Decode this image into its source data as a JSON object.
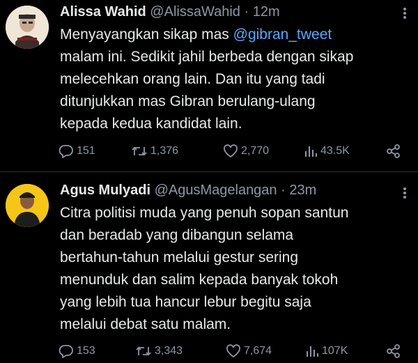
{
  "tweets": [
    {
      "name": "Alissa Wahid",
      "handle": "@AlissaWahid",
      "separator": "·",
      "time": "12m",
      "lines": [
        {
          "before": "Menyayangkan sikap mas ",
          "mention": "@gibran_tweet",
          "after": ""
        },
        {
          "before": "malam ini. Sedikit jahil berbeda dengan sikap",
          "mention": "",
          "after": ""
        },
        {
          "before": "melecehkan orang lain. Dan itu yang tadi",
          "mention": "",
          "after": ""
        },
        {
          "before": "ditunjukkan mas Gibran berulang-ulang",
          "mention": "",
          "after": ""
        },
        {
          "before": "kepada kedua kandidat lain.",
          "mention": "",
          "after": ""
        }
      ],
      "stats": {
        "replies": "151",
        "retweets": "1,376",
        "likes": "2,770",
        "views": "43.5K"
      }
    },
    {
      "name": "Agus Mulyadi",
      "handle": "@AgusMagelangan",
      "separator": "·",
      "time": "23m",
      "lines": [
        {
          "before": "Citra politisi muda yang penuh sopan santun"
        },
        {
          "before": "dan beradab yang dibangun selama"
        },
        {
          "before": "bertahun-tahun melalui gestur sering"
        },
        {
          "before": "menunduk dan salim kepada banyak tokoh"
        },
        {
          "before": "yang lebih tua hancur lebur begitu saja"
        },
        {
          "before": "melalui debat satu malam."
        }
      ],
      "stats": {
        "replies": "153",
        "retweets": "3,343",
        "likes": "7,674",
        "views": "107K"
      }
    }
  ],
  "icons": {
    "reply": "reply-icon",
    "retweet": "retweet-icon",
    "like": "heart-icon",
    "views": "views-icon",
    "share": "share-icon",
    "more": "more-icon"
  },
  "colors": {
    "background": "#000000",
    "text": "#e7e9ea",
    "muted": "#8b98a5",
    "mention": "#5aa7ff"
  }
}
